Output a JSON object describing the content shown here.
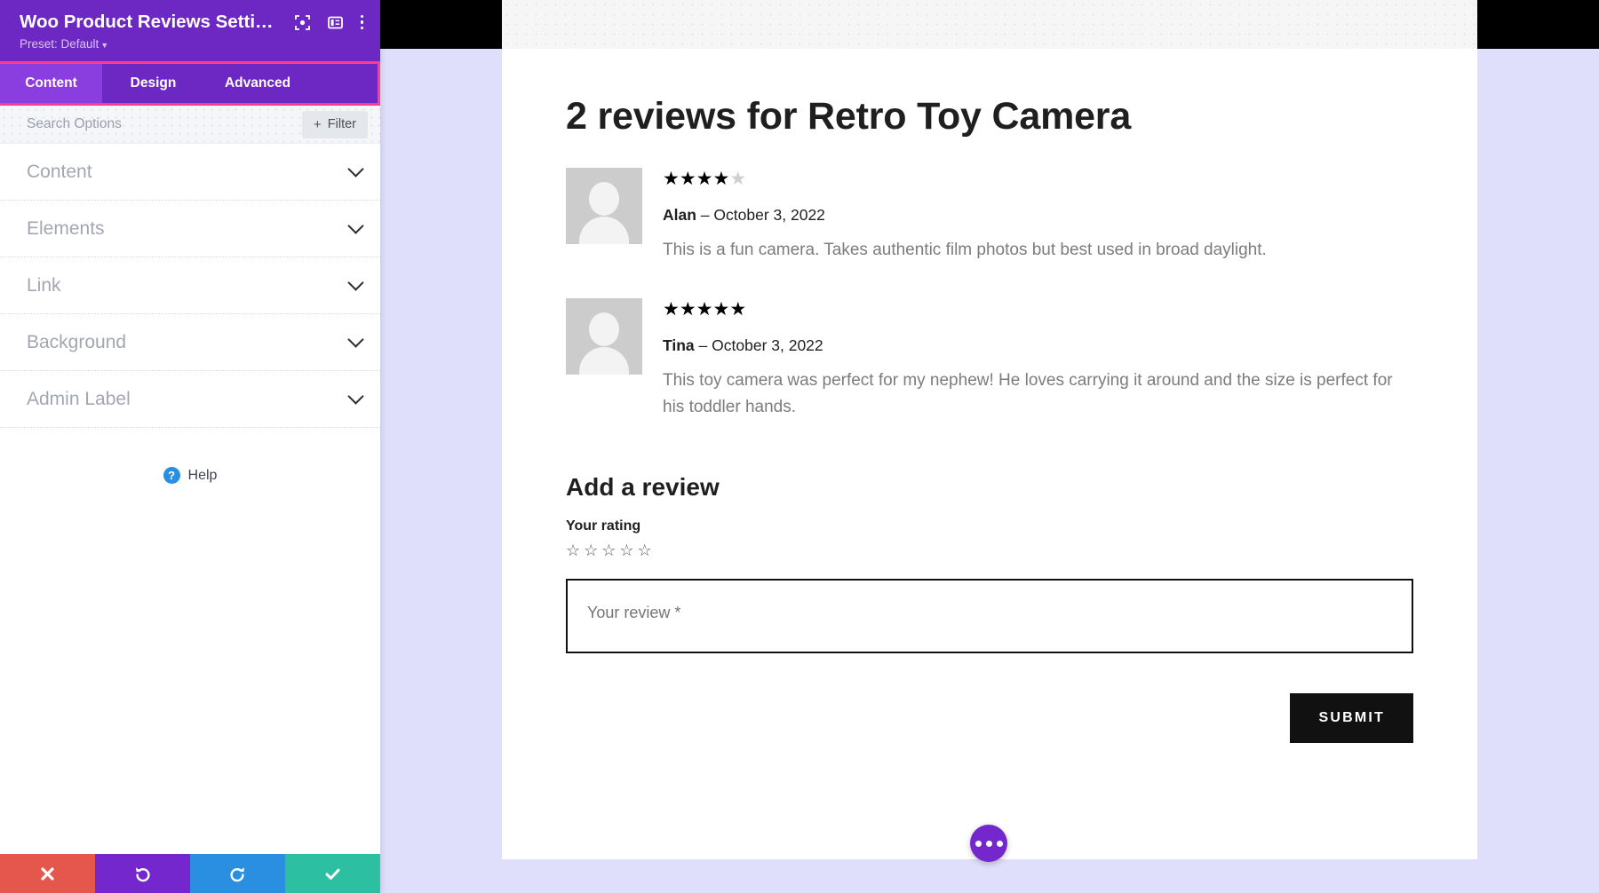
{
  "panel": {
    "title": "Woo Product Reviews Setti…",
    "preset": "Preset: Default",
    "header_icons": [
      {
        "name": "focus-icon"
      },
      {
        "name": "layout-panel-icon"
      },
      {
        "name": "more-vertical-icon"
      }
    ],
    "tabs": [
      {
        "label": "Content",
        "active": true
      },
      {
        "label": "Design",
        "active": false
      },
      {
        "label": "Advanced",
        "active": false
      }
    ],
    "highlight_color": "#ff3d8b",
    "search": {
      "placeholder": "Search Options",
      "value": ""
    },
    "filter_label": "Filter",
    "filter_plus": "+",
    "accordions": [
      {
        "label": "Content"
      },
      {
        "label": "Elements"
      },
      {
        "label": "Link"
      },
      {
        "label": "Background"
      },
      {
        "label": "Admin Label"
      }
    ],
    "help_label": "Help",
    "help_glyph": "?",
    "footer": [
      {
        "name": "cancel-button",
        "color": "#e5564c"
      },
      {
        "name": "undo-button",
        "color": "#7327cc"
      },
      {
        "name": "redo-button",
        "color": "#2a8fe0"
      },
      {
        "name": "save-button",
        "color": "#2cbfa1"
      }
    ]
  },
  "page": {
    "reviews_title": "2 reviews for Retro Toy Camera",
    "reviews": [
      {
        "rating": 4,
        "max_rating": 5,
        "author": "Alan",
        "dash": " – ",
        "date": "October 3, 2022",
        "text": "This is a fun camera. Takes authentic film photos but best used in broad daylight."
      },
      {
        "rating": 5,
        "max_rating": 5,
        "author": "Tina",
        "dash": " – ",
        "date": "October 3, 2022",
        "text": "This toy camera was perfect for my nephew! He loves carrying it around and the size is perfect for his toddler hands."
      }
    ],
    "add_review": {
      "title": "Add a review",
      "rating_label": "Your rating",
      "rating_value": 0,
      "rating_max": 5,
      "textarea_placeholder": "Your review *",
      "textarea_value": "",
      "submit_label": "SUBMIT"
    },
    "fab": {
      "name": "more-options-fab"
    }
  }
}
